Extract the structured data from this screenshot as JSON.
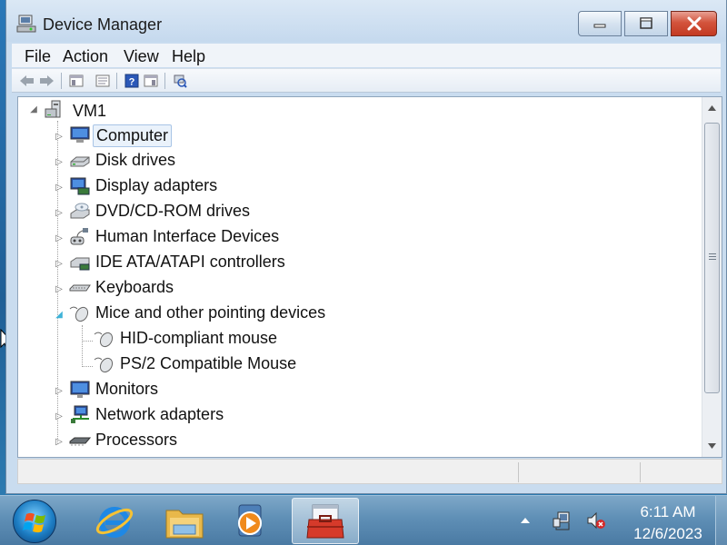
{
  "window": {
    "title": "Device Manager",
    "icons": {
      "title": "device-manager-icon",
      "minimize": "minimize-icon",
      "maximize": "maximize-icon",
      "close": "close-icon"
    }
  },
  "menu": {
    "items": [
      "File",
      "Action",
      "View",
      "Help"
    ]
  },
  "toolbar": {
    "buttons": [
      "back-arrow-icon",
      "forward-arrow-icon",
      "show-hide-console-tree-icon",
      "properties-icon",
      "help-icon",
      "show-hide-action-pane-icon",
      "scan-hardware-changes-icon"
    ]
  },
  "tree": {
    "root": {
      "label": "VM1",
      "icon": "computer-tower-icon",
      "expanded": true
    },
    "items": [
      {
        "label": "Computer",
        "icon": "computer-icon",
        "selected": true,
        "expanded": false
      },
      {
        "label": "Disk drives",
        "icon": "disk-drive-icon",
        "expanded": false
      },
      {
        "label": "Display adapters",
        "icon": "display-adapter-icon",
        "expanded": false
      },
      {
        "label": "DVD/CD-ROM drives",
        "icon": "dvd-drive-icon",
        "expanded": false
      },
      {
        "label": "Human Interface Devices",
        "icon": "hid-icon",
        "expanded": false
      },
      {
        "label": "IDE ATA/ATAPI controllers",
        "icon": "ide-controller-icon",
        "expanded": false
      },
      {
        "label": "Keyboards",
        "icon": "keyboard-icon",
        "expanded": false
      },
      {
        "label": "Mice and other pointing devices",
        "icon": "mouse-icon",
        "expanded": true,
        "children": [
          {
            "label": "HID-compliant mouse",
            "icon": "mouse-icon"
          },
          {
            "label": "PS/2 Compatible Mouse",
            "icon": "mouse-icon"
          }
        ]
      },
      {
        "label": "Monitors",
        "icon": "monitor-icon",
        "expanded": false
      },
      {
        "label": "Network adapters",
        "icon": "network-adapter-icon",
        "expanded": false
      },
      {
        "label": "Processors",
        "icon": "processor-icon",
        "expanded": false
      }
    ]
  },
  "taskbar": {
    "apps": [
      "internet-explorer-icon",
      "file-explorer-icon",
      "media-player-icon",
      "device-manager-toolbox-icon"
    ],
    "active_app": "device-manager-toolbox-icon",
    "tray": [
      "show-hidden-icons-arrow-icon",
      "network-icon",
      "volume-muted-icon"
    ],
    "clock": {
      "time": "6:11 AM",
      "date": "12/6/2023"
    }
  },
  "colors": {
    "selection_border": "#a8c4e6",
    "selection_fill": "#eaf2fb",
    "close_red": "#c33a22",
    "taskbar_blue": "#5f8fb6"
  }
}
